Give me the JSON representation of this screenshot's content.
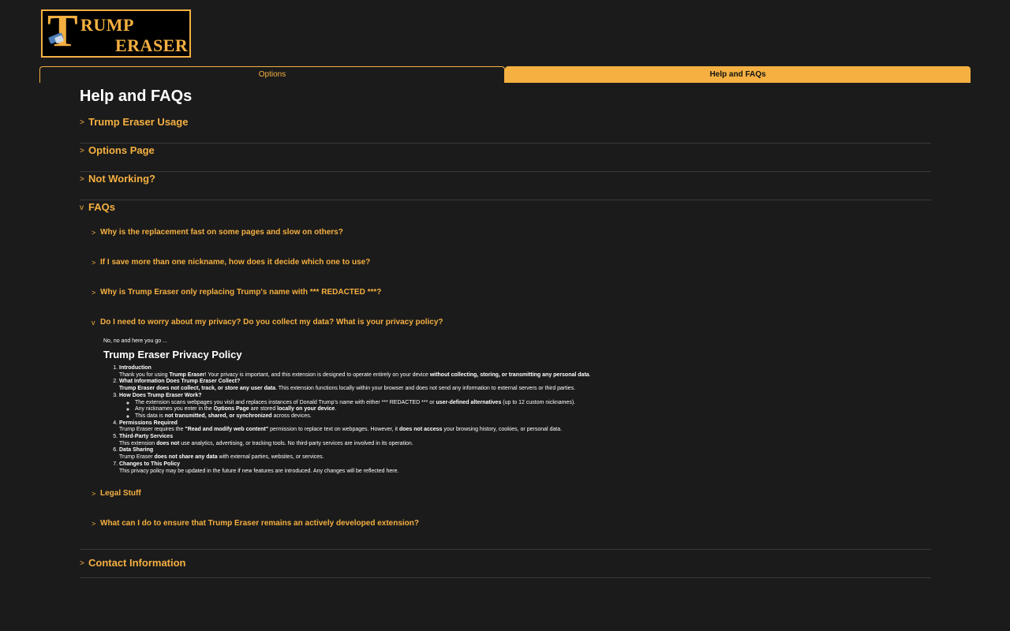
{
  "logo": {
    "letter": "T",
    "word1": "RUMP",
    "word2": "ERASER"
  },
  "tabs": [
    {
      "label": "Options",
      "active": false
    },
    {
      "label": "Help and FAQs",
      "active": true
    }
  ],
  "page": {
    "title": "Help and FAQs"
  },
  "sections": {
    "usage": {
      "label": "Trump Eraser Usage",
      "caret": ">"
    },
    "options": {
      "label": "Options Page",
      "caret": ">"
    },
    "not_working": {
      "label": "Not Working?",
      "caret": ">"
    },
    "faqs": {
      "label": "FAQs",
      "caret": "v"
    },
    "contact": {
      "label": "Contact Information",
      "caret": ">"
    }
  },
  "faqs": {
    "q1": {
      "label": "Why is the replacement fast on some pages and slow on others?",
      "caret": ">"
    },
    "q2": {
      "label": "If I save more than one nickname, how does it decide which one to use?",
      "caret": ">"
    },
    "q3": {
      "label": "Why is Trump Eraser only replacing Trump's name with *** REDACTED ***?",
      "caret": ">"
    },
    "q4": {
      "label": "Do I need to worry about my privacy? Do you collect my data? What is your privacy policy?",
      "caret": "v"
    },
    "q5": {
      "label": "Legal Stuff",
      "caret": ">"
    },
    "q6": {
      "label": "What can I do to ensure that Trump Eraser remains an actively developed extension?",
      "caret": ">"
    }
  },
  "privacy": {
    "lead": "No, no and here you go ...",
    "title": "Trump Eraser Privacy Policy",
    "items": [
      {
        "title": "Introduction",
        "parts": [
          "Thank you for using ",
          "Trump Eraser",
          "! Your privacy is important, and this extension is designed to operate entirely on your device ",
          "without collecting, storing, or transmitting any personal data",
          "."
        ]
      },
      {
        "title": "What Information Does Trump Eraser Collect?",
        "parts": [
          "Trump Eraser does not collect, track, or store any user data",
          ". This extension functions locally within your browser and does not send any information to external servers or third parties."
        ]
      },
      {
        "title": "How Does Trump Eraser Work?",
        "bullets": [
          [
            "The extension scans webpages you visit and replaces instances of Donald Trump's name with either *** REDACTED *** or ",
            "user-defined alternatives",
            " (up to 12 custom nicknames)."
          ],
          [
            "Any nicknames you enter in the ",
            "Options Page",
            " are stored ",
            "locally on your device",
            "."
          ],
          [
            "This data is ",
            "not transmitted, shared, or synchronized",
            " across devices."
          ]
        ]
      },
      {
        "title": "Permissions Required",
        "parts": [
          "Trump Eraser requires the ",
          "\"Read and modify web content\"",
          " permission to replace text on webpages. However, it ",
          "does not access",
          " your browsing history, cookies, or personal data."
        ]
      },
      {
        "title": "Third-Party Services",
        "parts": [
          "This extension ",
          "does not",
          " use analytics, advertising, or tracking tools. No third-party services are involved in its operation."
        ]
      },
      {
        "title": "Data Sharing",
        "parts": [
          "Trump Eraser ",
          "does not share any data",
          " with external parties, websites, or services."
        ]
      },
      {
        "title": "Changes to This Policy",
        "parts": [
          "This privacy policy may be updated in the future if new features are introduced. Any changes will be reflected here."
        ]
      }
    ]
  },
  "colors": {
    "accent": "#f5b041",
    "background": "#1b1b1b",
    "divider": "#3a3a3a",
    "text": "#ffffff"
  }
}
